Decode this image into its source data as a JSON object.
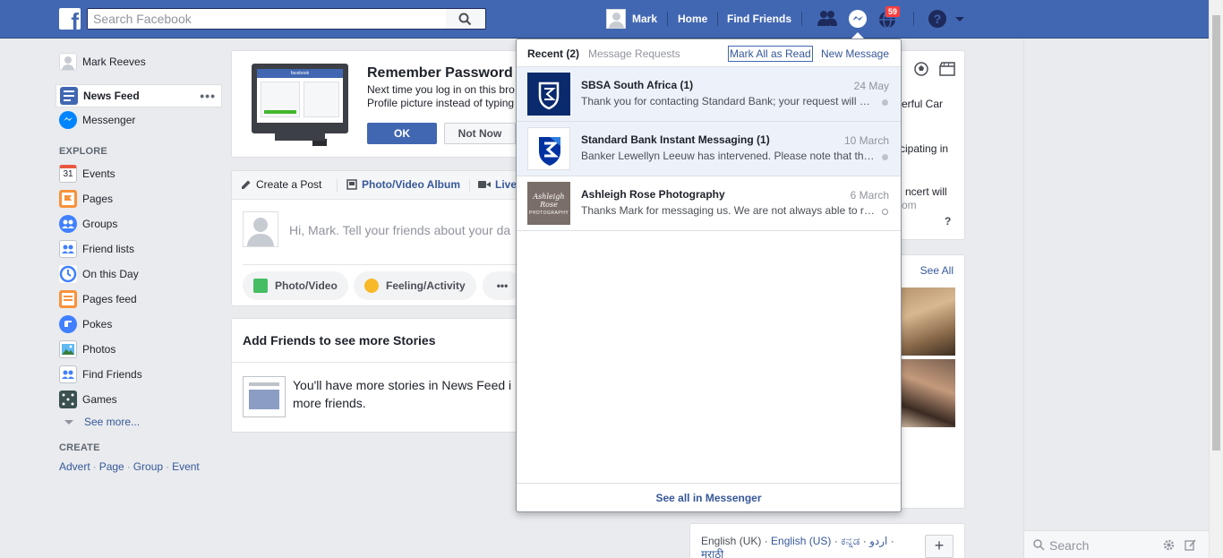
{
  "topbar": {
    "logo": "f",
    "search_placeholder": "Search Facebook",
    "user_name": "Mark",
    "home_label": "Home",
    "find_friends_label": "Find Friends",
    "notifications_count": "59",
    "icons": [
      "facebook-logo-icon",
      "search-icon",
      "friend-requests-icon",
      "messenger-icon",
      "notifications-icon",
      "help-icon",
      "caret-down-icon"
    ]
  },
  "leftnav": {
    "profile_name": "Mark Reeves",
    "news_feed": "News Feed",
    "news_feed_more": "•••",
    "messenger": "Messenger",
    "explore_heading": "EXPLORE",
    "explore_items": [
      "Events",
      "Pages",
      "Groups",
      "Friend lists",
      "On this Day",
      "Pages feed",
      "Pokes",
      "Photos",
      "Find Friends",
      "Games"
    ],
    "events_day": "31",
    "see_more": "See more...",
    "create_heading": "CREATE",
    "create_links": [
      "Advert",
      "Page",
      "Group",
      "Event"
    ],
    "create_sep": "·"
  },
  "remember_password": {
    "title": "Remember Password",
    "text_line1": "Next time you log in on this bro",
    "text_line2": "Profile picture instead of typing",
    "ok_label": "OK",
    "not_now_label": "Not Now",
    "screen_brand": "facebook"
  },
  "composer": {
    "tab_create_post": "Create a Post",
    "tab_photo_album": "Photo/Video Album",
    "tab_live": "Live",
    "placeholder": "Hi, Mark. Tell your friends about your da",
    "photo_video": "Photo/Video",
    "feeling_activity": "Feeling/Activity",
    "more": "•••"
  },
  "stories": {
    "title": "Add Friends to see more Stories",
    "text_line1": "You'll have more stories in News Feed i",
    "text_line2": "more friends."
  },
  "right_column": {
    "card1_line1": "erful Car",
    "card1_line2": "cipating in",
    "card1_line3": "ncert will",
    "card1_line4": "om",
    "card1_question": "?",
    "see_all": "See All",
    "languages": {
      "english_uk": "English (UK)",
      "english_us": "English (US)",
      "kannada": "ಕನ್ನಡ",
      "urdu": "اردو",
      "marathi": "मराठी",
      "sep": "·"
    },
    "plus": "+"
  },
  "messages_dropdown": {
    "tab_recent": "Recent",
    "recent_count": "(2)",
    "tab_requests": "Message Requests",
    "mark_all_read": "Mark All as Read",
    "new_message": "New Message",
    "threads": [
      {
        "name": "SBSA South Africa (1)",
        "time": "24 May",
        "snippet": "Thank you for contacting Standard Bank; your request will be attended to shortly.",
        "unread": true
      },
      {
        "name": "Standard Bank Instant Messaging (1)",
        "time": "10 March",
        "snippet": "Banker Lewellyn Leeuw has intervened. Please note that this conversation is being recorded.",
        "unread": true
      },
      {
        "name": "Ashleigh Rose Photography",
        "time": "6 March",
        "snippet": "Thanks Mark for messaging us. We are not always able to respond immediately.",
        "unread": false
      }
    ],
    "avatar3_line1": "Ashleigh Rose",
    "avatar3_line2": "PHOTOGRAPHY",
    "see_all": "See all in Messenger"
  },
  "chat": {
    "search_placeholder": "Search"
  },
  "colors": {
    "brand_blue": "#4267b2",
    "link_blue": "#365899",
    "badge_red": "#fa3e3e",
    "unread_bg": "#edf2fa"
  }
}
